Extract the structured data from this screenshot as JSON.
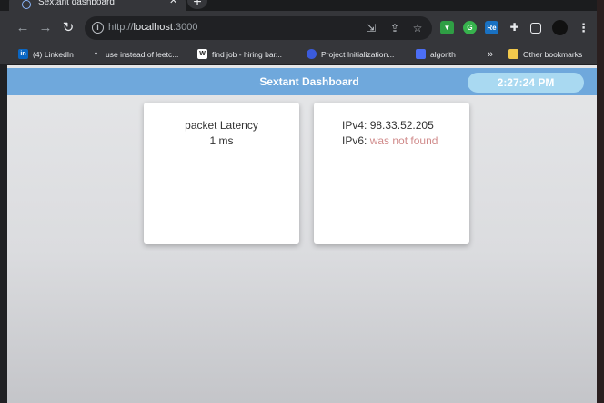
{
  "browser": {
    "tab": {
      "title": "Sextant dashboard",
      "close_glyph": "✕",
      "favicon": "react-icon"
    },
    "new_tab_glyph": "+",
    "nav": {
      "back_glyph": "←",
      "forward_glyph": "→",
      "reload_glyph": "↻"
    },
    "omnibox": {
      "scheme": "http://",
      "host": "localhost",
      "port": ":3000"
    },
    "bookmarks": [
      {
        "label": "(4) LinkedIn",
        "icon": "linkedin-icon",
        "icon_text": "in",
        "color": "#0a66c2"
      },
      {
        "label": "use instead of leetc...",
        "icon": "pin-icon",
        "icon_text": "",
        "color": "#e8eaed"
      },
      {
        "label": "find job - hiring bar...",
        "icon": "w-icon",
        "icon_text": "W",
        "color": "#ffffff"
      },
      {
        "label": "Project Initialization...",
        "icon": "globe-icon",
        "icon_text": "",
        "color": "#3b5bdb"
      },
      {
        "label": "algorith",
        "icon": "doc-icon",
        "icon_text": "",
        "color": "#4c6ef5"
      }
    ],
    "bookmarks_overflow": "»",
    "other_bookmarks": "Other bookmarks"
  },
  "app": {
    "title": "Sextant Dashboard",
    "clock": "2:27:24 PM",
    "accent_color": "#6fa8dc",
    "latency_card": {
      "label": "packet Latency",
      "value": "1 ms"
    },
    "ip_card": {
      "ipv4_label": "IPv4:",
      "ipv4_value": "98.33.52.205",
      "ipv6_label": "IPv6:",
      "ipv6_value": "was not found"
    }
  }
}
